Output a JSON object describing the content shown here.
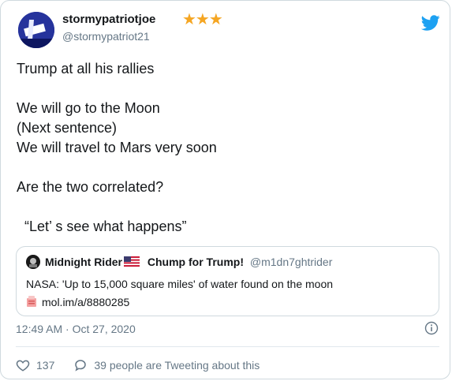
{
  "user": {
    "display_name": "stormypatriotjoe",
    "stars": "★★★",
    "handle": "@stormypatriot21"
  },
  "tweet": {
    "text": "Trump at all his rallies\n\nWe will go to the Moon\n(Next sentence)\nWe will travel to Mars very soon\n\nAre the two correlated?\n\n  “Let’ s see what happens”"
  },
  "quoted": {
    "name": "Midnight Rider",
    "name_suffix": "Chump for Trump!",
    "handle": "@m1dn7ghtrider",
    "text": "NASA: 'Up to 15,000 square miles' of water found on the moon",
    "link": "mol.im/a/8880285"
  },
  "meta": {
    "timestamp": "12:49 AM · Oct 27, 2020"
  },
  "actions": {
    "likes": "137",
    "talking": "39 people are Tweeting about this"
  },
  "colors": {
    "star": "#f5a623",
    "twitter_blue": "#1da1f2",
    "muted": "#657786"
  }
}
